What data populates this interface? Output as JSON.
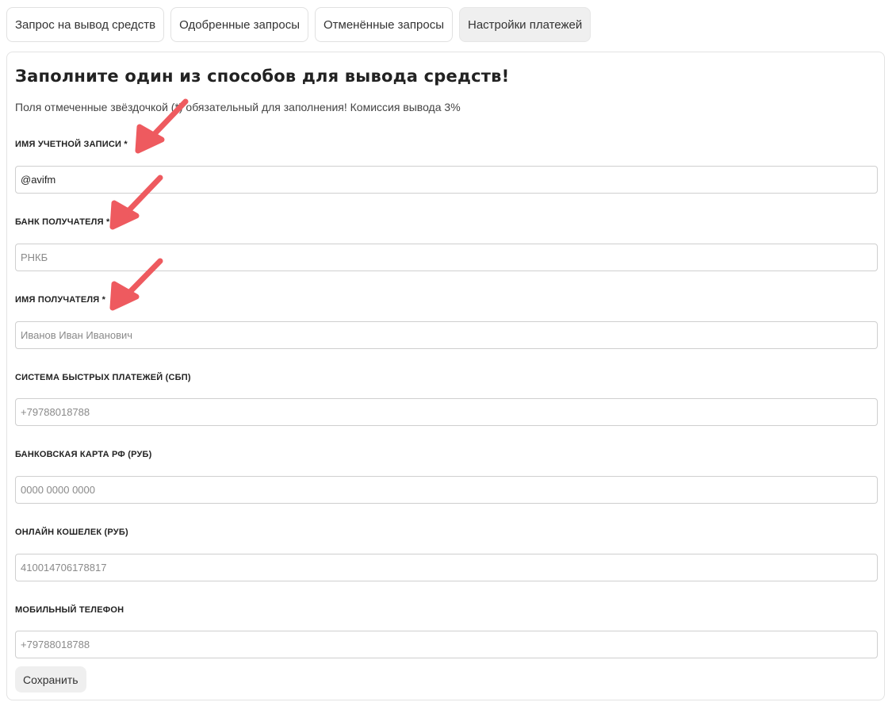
{
  "tabs": [
    {
      "label": "Запрос на вывод средств",
      "active": false
    },
    {
      "label": "Одобренные запросы",
      "active": false
    },
    {
      "label": "Отменённые запросы",
      "active": false
    },
    {
      "label": "Настройки платежей",
      "active": true
    }
  ],
  "form": {
    "title": "Заполните один из способов для вывода средств!",
    "subtitle": "Поля отмеченные звёздочкой (*) обязательный для заполнения! Комиссия вывода 3%",
    "fields": [
      {
        "label": "ИМЯ УЧЕТНОЙ ЗАПИСИ *",
        "value": "@avifm",
        "placeholder": ""
      },
      {
        "label": "БАНК ПОЛУЧАТЕЛЯ *",
        "value": "",
        "placeholder": "РНКБ"
      },
      {
        "label": "ИМЯ ПОЛУЧАТЕЛЯ *",
        "value": "",
        "placeholder": "Иванов Иван Иванович"
      },
      {
        "label": "СИСТЕМА БЫСТРЫХ ПЛАТЕЖЕЙ (СБП)",
        "value": "",
        "placeholder": "+79788018788"
      },
      {
        "label": "БАНКОВСКАЯ КАРТА РФ (РУБ)",
        "value": "",
        "placeholder": "0000 0000 0000"
      },
      {
        "label": "ОНЛАЙН КОШЕЛЕК (РУБ)",
        "value": "",
        "placeholder": "410014706178817"
      },
      {
        "label": "МОБИЛЬНЫЙ ТЕЛЕФОН",
        "value": "",
        "placeholder": "+79788018788"
      }
    ],
    "save_label": "Сохранить"
  },
  "colors": {
    "annotation_arrow": "#ee5a5f",
    "active_tab_bg": "#efefef",
    "input_border": "#cfcfcf"
  }
}
